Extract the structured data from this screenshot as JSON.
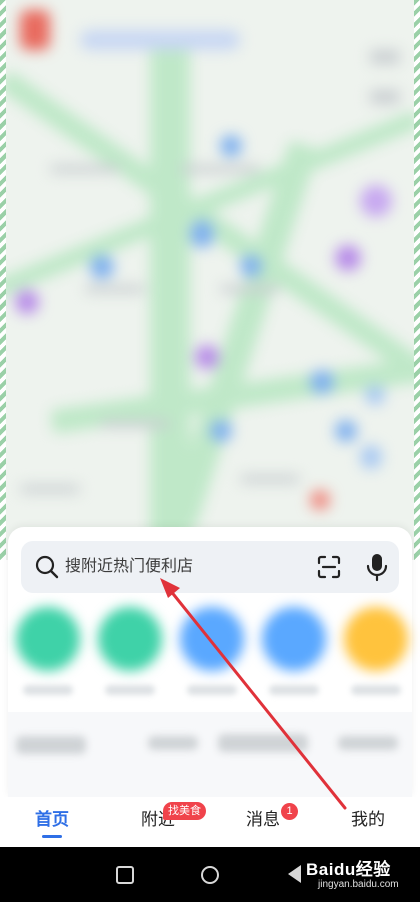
{
  "search": {
    "placeholder": "搜附近热门便利店"
  },
  "tabbar": {
    "tabs": [
      {
        "label": "首页",
        "active": true
      },
      {
        "label": "附近",
        "badge": "找美食"
      },
      {
        "label": "消息",
        "badge": "1"
      },
      {
        "label": "我的"
      }
    ]
  },
  "watermark": {
    "text": "Baidu经验",
    "url": "jingyan.baidu.com"
  },
  "colors": {
    "accent": "#2f6fe6",
    "badge": "#f0434b",
    "annotation_arrow": "#e0323a"
  },
  "icons": [
    "search-icon",
    "scan-icon",
    "microphone-icon",
    "nav-recents-icon",
    "nav-home-icon",
    "nav-back-icon"
  ]
}
